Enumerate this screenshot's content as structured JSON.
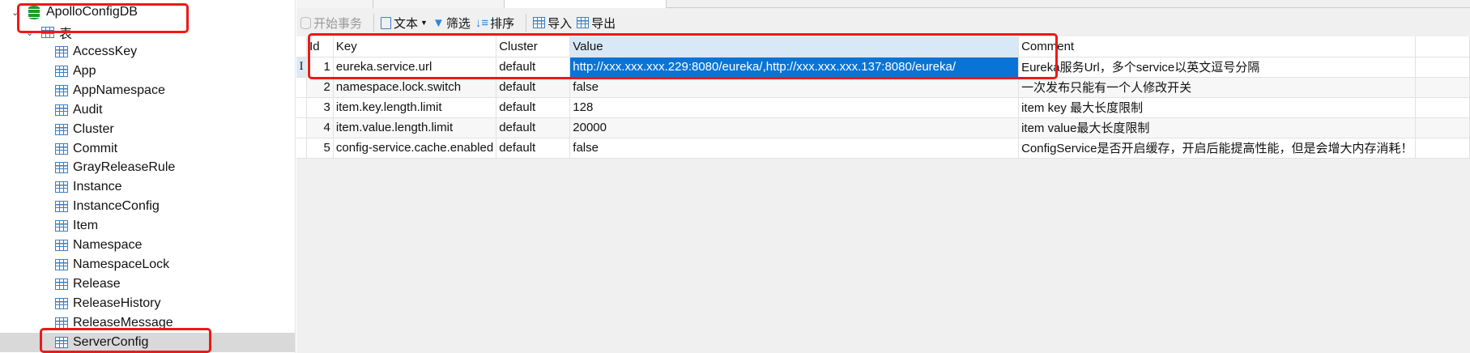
{
  "tree": {
    "database": "ApolloConfigDB",
    "tables_group": "表",
    "tables": [
      "AccessKey",
      "App",
      "AppNamespace",
      "Audit",
      "Cluster",
      "Commit",
      "GrayReleaseRule",
      "Instance",
      "InstanceConfig",
      "Item",
      "Namespace",
      "NamespaceLock",
      "Release",
      "ReleaseHistory",
      "ReleaseMessage",
      "ServerConfig"
    ],
    "selected": "ServerConfig"
  },
  "toolbar": {
    "begin_transaction": "开始事务",
    "text": "文本",
    "filter": "筛选",
    "sort": "排序",
    "import": "导入",
    "export": "导出"
  },
  "grid": {
    "columns": [
      "Id",
      "Key",
      "Cluster",
      "Value",
      "Comment"
    ],
    "rows": [
      {
        "id": "1",
        "key": "eureka.service.url",
        "cluster": "default",
        "value": "http://xxx.xxx.xxx.229:8080/eureka/,http://xxx.xxx.xxx.137:8080/eureka/",
        "comment": "Eureka服务Url，多个service以英文逗号分隔"
      },
      {
        "id": "2",
        "key": "namespace.lock.switch",
        "cluster": "default",
        "value": "false",
        "comment": "一次发布只能有一个人修改开关"
      },
      {
        "id": "3",
        "key": "item.key.length.limit",
        "cluster": "default",
        "value": "128",
        "comment": "item key 最大长度限制"
      },
      {
        "id": "4",
        "key": "item.value.length.limit",
        "cluster": "default",
        "value": "20000",
        "comment": "item value最大长度限制"
      },
      {
        "id": "5",
        "key": "config-service.cache.enabled",
        "cluster": "default",
        "value": "false",
        "comment": "ConfigService是否开启缓存，开启后能提高性能，但是会增大内存消耗！"
      }
    ],
    "current_row_marker": "I"
  },
  "colors": {
    "selection": "#0a74d6",
    "highlight_box": "#f01818",
    "db_icon": "#1e9a2e",
    "table_icon": "#3d7fc1"
  }
}
